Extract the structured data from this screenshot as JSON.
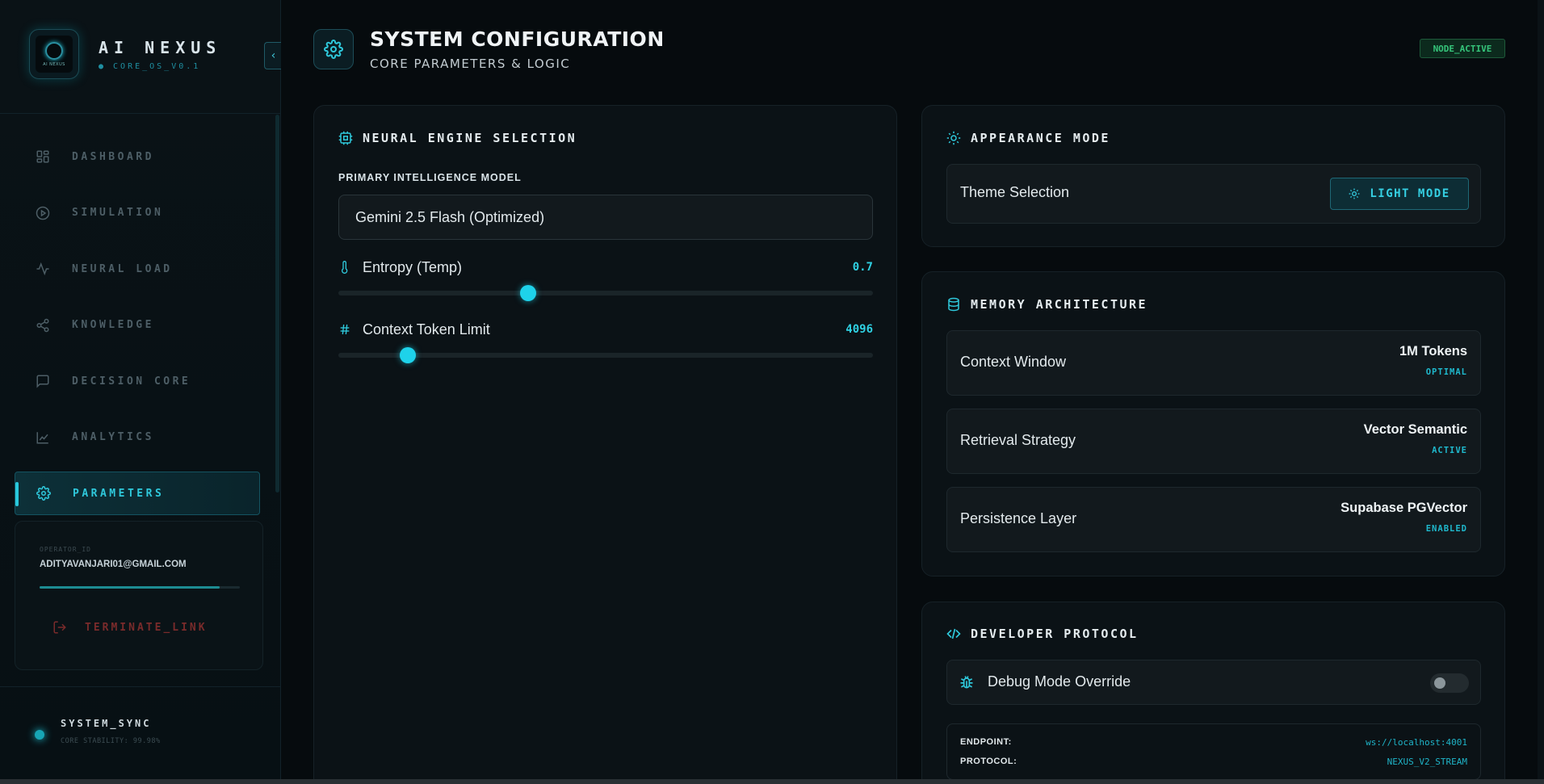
{
  "brand": {
    "name": "AI NEXUS",
    "subtitle": "● CORE_OS_V0.1",
    "logo_text": "AI NEXUS",
    "logo_icon": "nexus-logo-icon"
  },
  "sidebar": {
    "collapse_icon": "chevron-left-icon",
    "items": [
      {
        "label": "DASHBOARD",
        "icon": "grid-icon"
      },
      {
        "label": "SIMULATION",
        "icon": "play-circle-icon"
      },
      {
        "label": "NEURAL LOAD",
        "icon": "activity-icon"
      },
      {
        "label": "KNOWLEDGE",
        "icon": "share-nodes-icon"
      },
      {
        "label": "DECISION CORE",
        "icon": "message-square-icon"
      },
      {
        "label": "ANALYTICS",
        "icon": "line-chart-icon"
      },
      {
        "label": "PARAMETERS",
        "icon": "gear-icon",
        "active": true
      }
    ],
    "operator": {
      "label": "OPERATOR_ID",
      "email": "ADITYAVANJARI01@GMAIL.COM",
      "progress": 0.9,
      "terminate_label": "TERMINATE_LINK"
    },
    "sync": {
      "title": "SYSTEM_SYNC",
      "subtitle": "CORE STABILITY: 99.98%"
    }
  },
  "header": {
    "title": "SYSTEM CONFIGURATION",
    "subtitle": "CORE PARAMETERS & LOGIC",
    "status_badge": "NODE_ACTIVE"
  },
  "engine": {
    "title": "NEURAL ENGINE SELECTION",
    "model_label": "PRIMARY INTELLIGENCE MODEL",
    "model_value": "Gemini 2.5 Flash (Optimized)",
    "entropy": {
      "label": "Entropy (Temp)",
      "value": "0.7",
      "fraction": 0.355
    },
    "context": {
      "label": "Context Token Limit",
      "value": "4096",
      "fraction": 0.13
    }
  },
  "appearance": {
    "title": "APPEARANCE MODE",
    "theme_label": "Theme Selection",
    "button_label": "LIGHT MODE"
  },
  "memory": {
    "title": "MEMORY ARCHITECTURE",
    "rows": [
      {
        "label": "Context Window",
        "value": "1M Tokens",
        "status": "OPTIMAL"
      },
      {
        "label": "Retrieval Strategy",
        "value": "Vector Semantic",
        "status": "ACTIVE"
      },
      {
        "label": "Persistence Layer",
        "value": "Supabase PGVector",
        "status": "ENABLED"
      }
    ]
  },
  "developer": {
    "title": "DEVELOPER PROTOCOL",
    "debug_label": "Debug Mode Override",
    "debug_enabled": false,
    "endpoint_label": "ENDPOINT:",
    "endpoint_value": "ws://localhost:4001",
    "protocol_label": "PROTOCOL:",
    "protocol_value": "NEXUS_V2_STREAM"
  },
  "colors": {
    "accent": "#1ed2ea",
    "background": "#05090c",
    "status_green": "#35c47a",
    "danger": "#7a2b2b"
  }
}
